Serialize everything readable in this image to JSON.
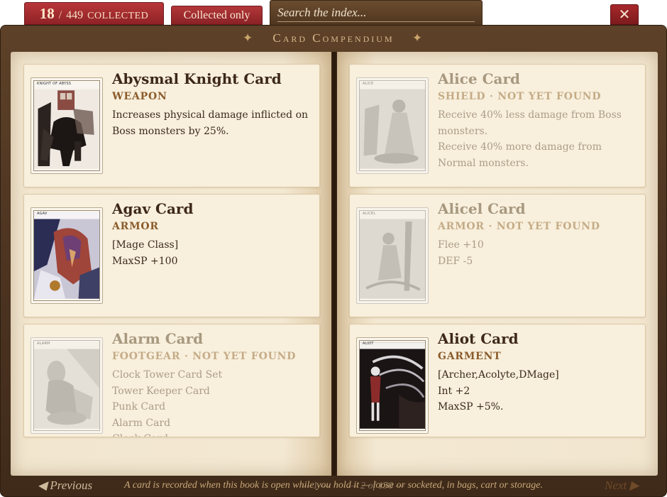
{
  "header": {
    "collected_count": "18",
    "slash": "/",
    "total_count": "449",
    "collected_label": "COLLECTED",
    "filter_label": "Collected only",
    "search_placeholder": "Search the index...",
    "close_glyph": "✕"
  },
  "book": {
    "title": "Card Compendium",
    "star": "✦",
    "footer_note": "A card is recorded when this book is open while you hold it — loose or socketed, in bags, cart or storage."
  },
  "left_page": {
    "cards": [
      {
        "name": "Abysmal Knight Card",
        "type": "WEAPON",
        "tag": "KNIGHT OF ABYSS",
        "collected": true,
        "desc": [
          "Increases physical damage inflicted on Boss monsters by 25%."
        ]
      },
      {
        "name": "Agav Card",
        "type": "ARMOR",
        "tag": "AGAV",
        "collected": true,
        "desc": [
          "[Mage Class]",
          "MaxSP +100"
        ]
      },
      {
        "name": "Alarm Card",
        "type": "FOOTGEAR · NOT YET FOUND",
        "tag": "ALARM",
        "collected": false,
        "desc": [
          "Clock Tower Card Set",
          "Tower Keeper Card",
          "Punk Card",
          "Alarm Card",
          "Clock Card"
        ]
      }
    ],
    "prev_label": "◀ Previous",
    "page_number": "— 1 —"
  },
  "right_page": {
    "cards": [
      {
        "name": "Alice Card",
        "type": "SHIELD · NOT YET FOUND",
        "tag": "ALICE",
        "collected": false,
        "desc": [
          "Receive 40% less damage from Boss monsters.",
          "Receive 40% more damage from Normal monsters."
        ]
      },
      {
        "name": "Alicel Card",
        "type": "ARMOR · NOT YET FOUND",
        "tag": "ALICEL",
        "collected": false,
        "desc": [
          "Flee +10",
          "DEF -5"
        ]
      },
      {
        "name": "Aliot Card",
        "type": "GARMENT",
        "tag": "ALIOT",
        "collected": true,
        "desc": [
          "[Archer,Acolyte,DMage]",
          "Int +2",
          "MaxSP +5%."
        ]
      }
    ],
    "page_number": "— 2 of 150 —",
    "next_label": "Next ▶"
  },
  "colors": {
    "accent_red": "#a5292c",
    "leather": "#4f3621",
    "parchment": "#f2e6cf",
    "ink": "#3d2817",
    "type_brown": "#8a5b2b"
  }
}
